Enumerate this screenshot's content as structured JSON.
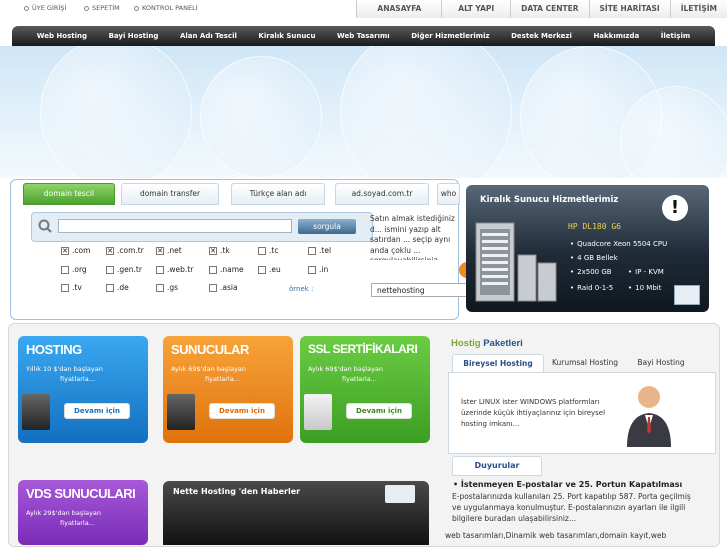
{
  "top_links": [
    {
      "label": "ÜYE GİRİŞİ"
    },
    {
      "label": "SEPETİM"
    },
    {
      "label": "KONTROL PANELİ"
    }
  ],
  "site_nav": [
    "ANASAYFA",
    "ALT YAPI",
    "DATA CENTER",
    "SİTE HARİTASI",
    "İLETİŞİM"
  ],
  "main_nav": [
    "Web Hosting",
    "Bayi Hosting",
    "Alan Adı Tescil",
    "Kiralık Sunucu",
    "Web Tasarımı",
    "Diğer Hizmetlerimiz",
    "Destek Merkezi",
    "Hakkımızda",
    "İletişim"
  ],
  "domain": {
    "tabs": [
      "domain tescil",
      "domain transfer",
      "Türkçe alan adı",
      "ad.soyad.com.tr",
      "who"
    ],
    "search_button": "sorgula",
    "tlds": [
      {
        "label": ".com",
        "checked": true
      },
      {
        "label": ".com.tr",
        "checked": true
      },
      {
        "label": ".net",
        "checked": true
      },
      {
        "label": ".tk",
        "checked": true
      },
      {
        "label": ".tc",
        "checked": false
      },
      {
        "label": ".tel",
        "checked": false
      },
      {
        "label": ".org",
        "checked": false
      },
      {
        "label": ".gen.tr",
        "checked": false
      },
      {
        "label": ".web.tr",
        "checked": false
      },
      {
        "label": ".name",
        "checked": false
      },
      {
        "label": ".eu",
        "checked": false
      },
      {
        "label": ".in",
        "checked": false
      },
      {
        "label": ".tv",
        "checked": false
      },
      {
        "label": ".de",
        "checked": false
      },
      {
        "label": ".gs",
        "checked": false
      },
      {
        "label": ".asia",
        "checked": false
      }
    ],
    "side_text": "Satın almak istediğiniz d... ismini yazıp alt satırdan ... seçip aynı anda çoklu ... sorgulayabilirsiniz.",
    "ornek_label": "örnek :",
    "example_value": "nettehosting"
  },
  "server": {
    "title": "Kiralık Sunucu Hizmetlerimiz",
    "model": "HP DL180 G6",
    "specs": [
      "Quadcore Xeon 5504 CPU",
      "4 GB Bellek",
      "2x500 GB",
      "IP - KVM",
      "Raid 0-1-5",
      "10 Mbit"
    ],
    "alert": "!"
  },
  "cards": [
    {
      "title": "HOSTING",
      "sub1": "Yıllık 10 $'dan başlayan",
      "sub2": "fiyatlarla...",
      "button": "Devamı için",
      "color": "blue"
    },
    {
      "title": "SUNUCULAR",
      "sub1": "Aylık 69$'dan başlayan",
      "sub2": "fiyatlarla...",
      "button": "Devamı için",
      "color": "orange"
    },
    {
      "title": "SSL SERTİFİKALARI",
      "sub1": "Aylık 69$'dan başlayan",
      "sub2": "fiyatlarla...",
      "button": "Devamı için",
      "color": "green"
    },
    {
      "title": "VDS SUNUCULARI",
      "sub1": "Aylık 29$'dan başlayan",
      "sub2": "fiyatlarla...",
      "button": "",
      "color": "purple"
    }
  ],
  "haberler_title": "Nette Hosting 'den Haberler",
  "paket": {
    "title_part1": "Hostig",
    "title_part2": " Paketleri",
    "tabs": [
      "Bireysel Hosting",
      "Kurumsal Hosting",
      "Bayi Hosting"
    ],
    "text": "İster LINUX ister WINDOWS platformları üzerinde küçük ihtiyaçlarınız için bireysel hosting imkanı..."
  },
  "duyurular": {
    "tab": "Duyurular",
    "title": "• İstenmeyen E-postalar ve 25. Portun Kapatılması",
    "body": "E-postalarınızda kullanılan 25. Port kapatılıp 587. Porta geçilmiş ve uygulanmaya konulmuştur. E-postalarınızın ayarları ile ilgili bilgilere buradan ulaşabilirsiniz..."
  },
  "footer_text": "web tasarımları,Dinamik web tasarımları,domain kayıt,web",
  "colors": {
    "blue": "#1e8fe0",
    "orange": "#f08a1c",
    "green": "#4cb82e",
    "purple": "#8a3cc4",
    "accent_green": "#7aa83a"
  }
}
